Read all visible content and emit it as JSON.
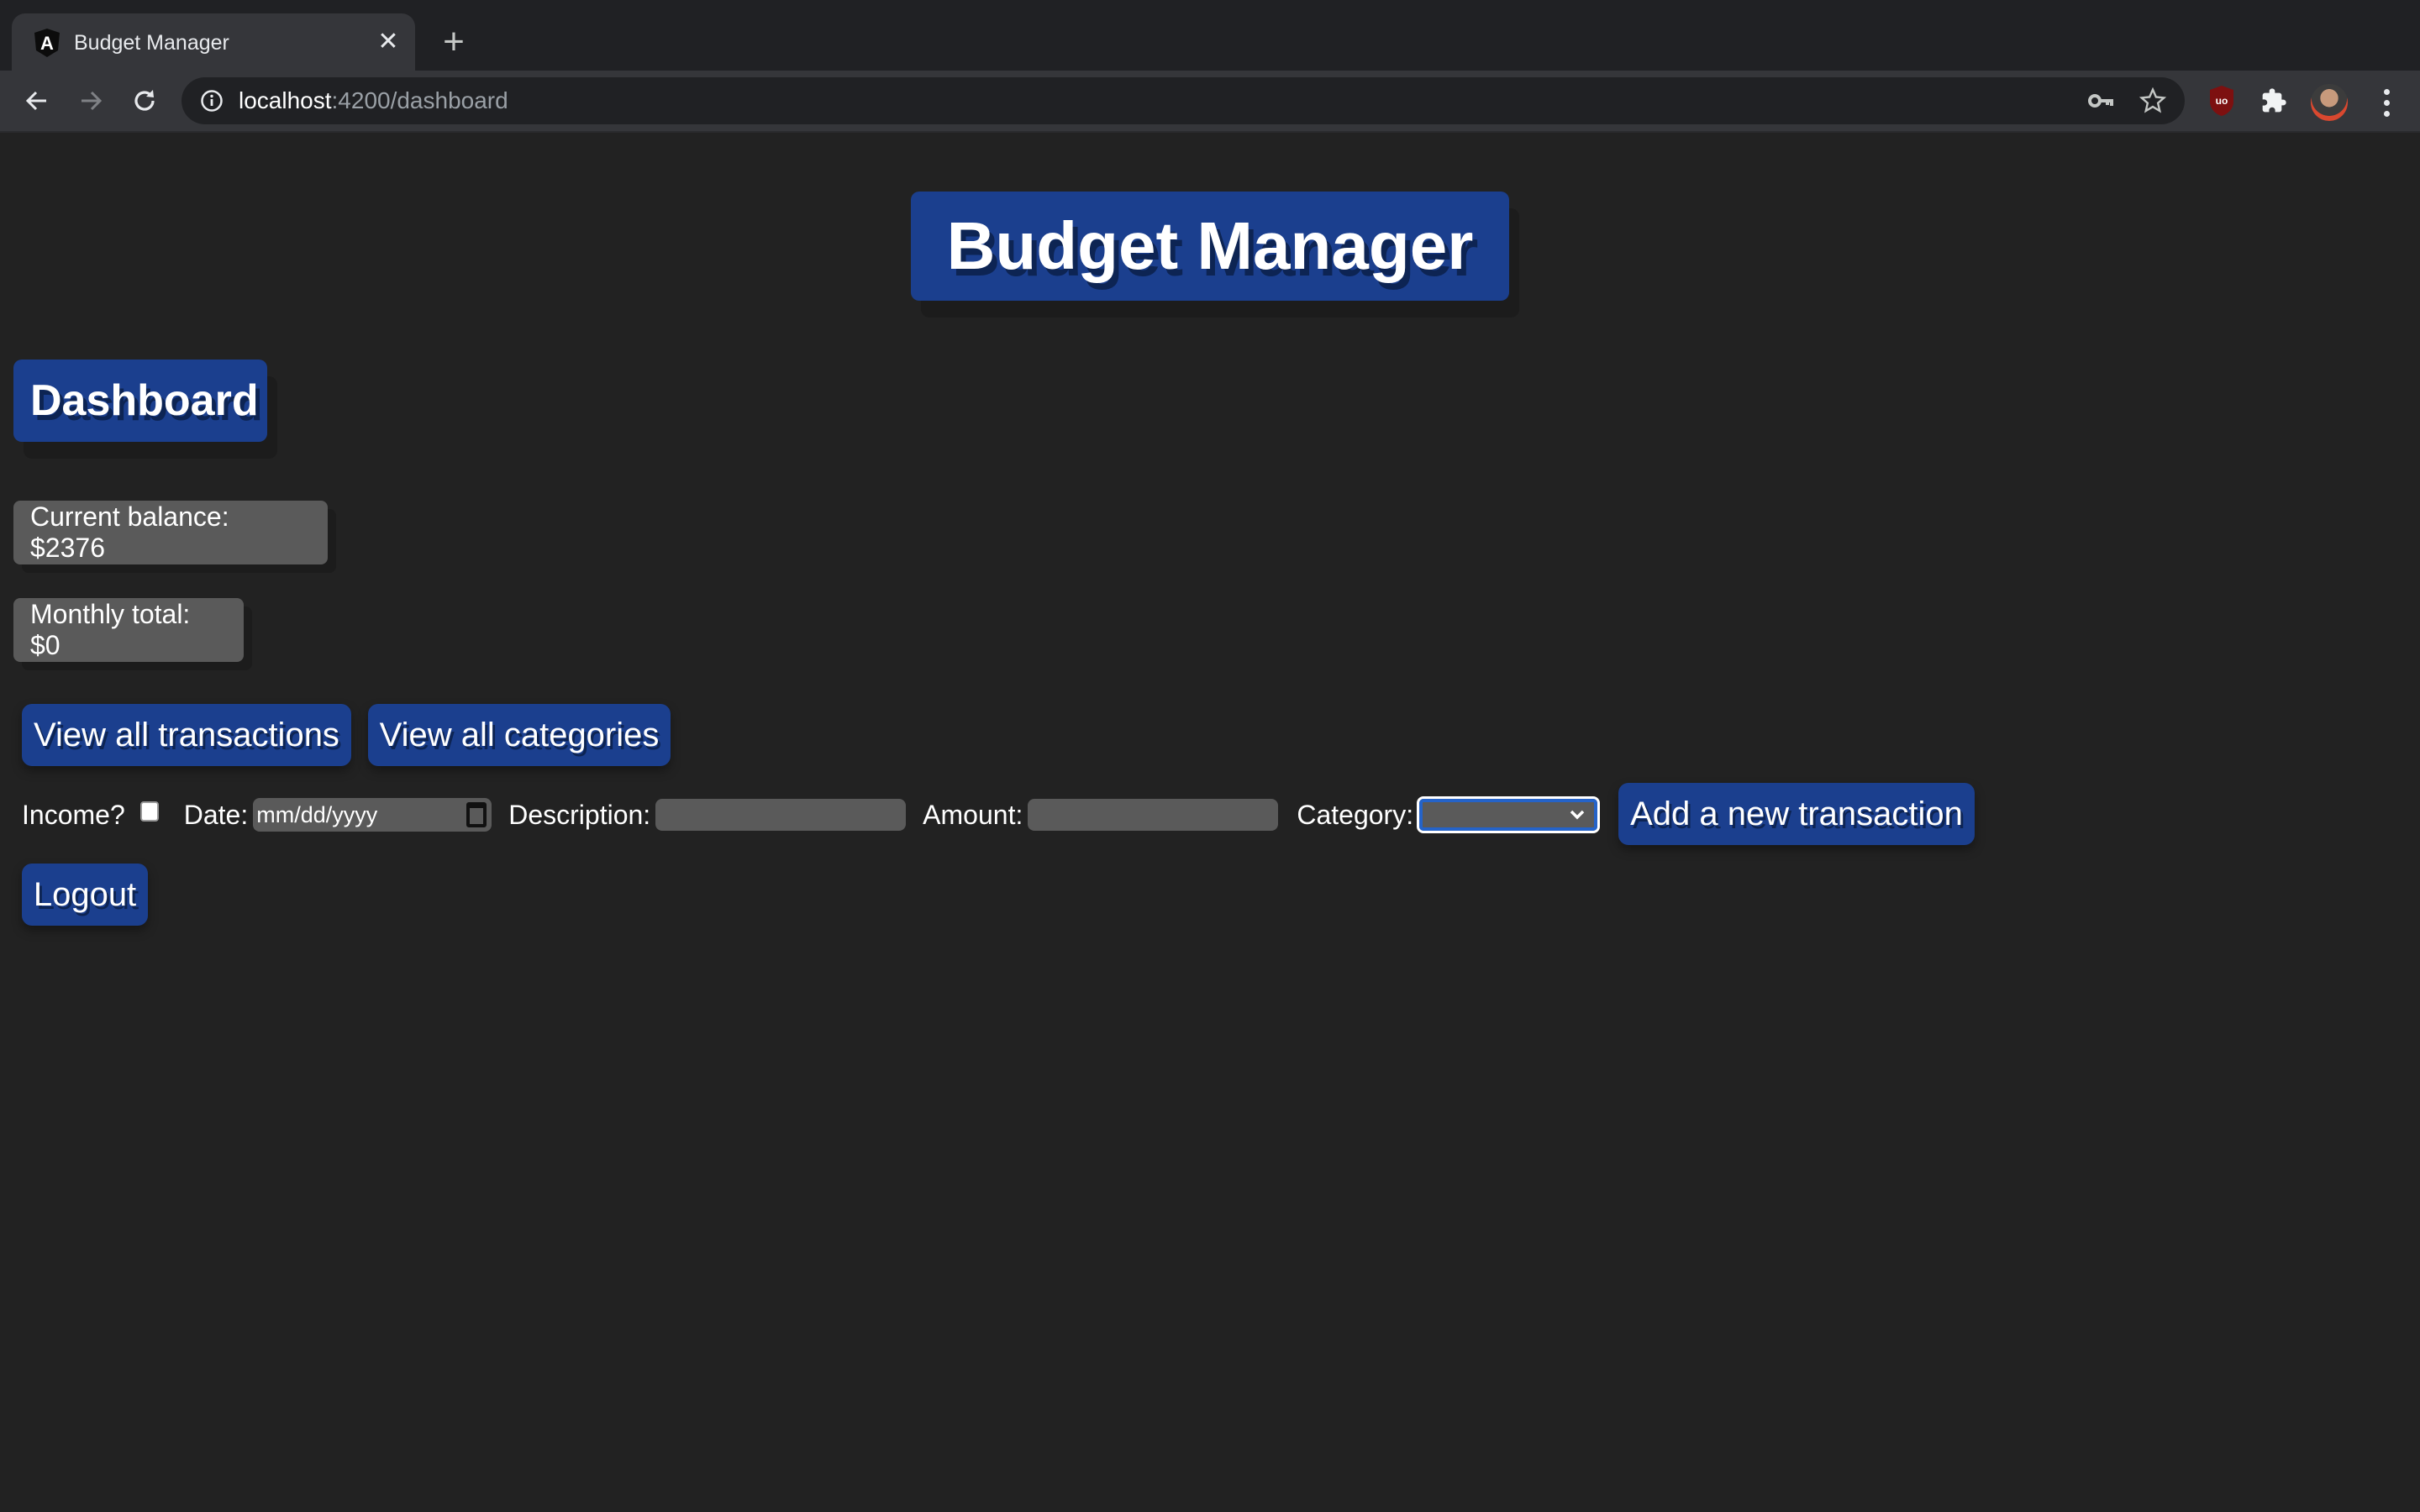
{
  "browser": {
    "tab": {
      "title": "Budget Manager",
      "favicon": "angular-icon",
      "close_glyph": "✕"
    },
    "new_tab_glyph": "+",
    "url": {
      "host": "localhost",
      "rest": ":4200/dashboard"
    },
    "toolbar_icons": [
      "back-icon",
      "forward-icon",
      "reload-icon",
      "info-icon",
      "key-icon",
      "star-icon",
      "ublock-icon",
      "extensions-icon",
      "avatar",
      "menu-icon"
    ]
  },
  "header": {
    "title": "Budget Manager"
  },
  "page": {
    "heading": "Dashboard"
  },
  "stats": {
    "current_balance": "Current balance: $2376",
    "monthly_total": "Monthly total: $0"
  },
  "nav_buttons": {
    "view_transactions": "View all transactions",
    "view_categories": "View all categories"
  },
  "form": {
    "income_label": "Income?",
    "income_checked": false,
    "date_label": "Date:",
    "date_placeholder": "mm/dd/yyyy",
    "description_label": "Description:",
    "description_value": "",
    "amount_label": "Amount:",
    "amount_value": "",
    "category_label": "Category:",
    "category_selected": "",
    "submit_label": "Add a new transaction"
  },
  "logout_label": "Logout",
  "colors": {
    "background": "#222222",
    "primary": "#1b3f8e",
    "panel": "#5a5a5a",
    "focus": "#2563c8"
  }
}
